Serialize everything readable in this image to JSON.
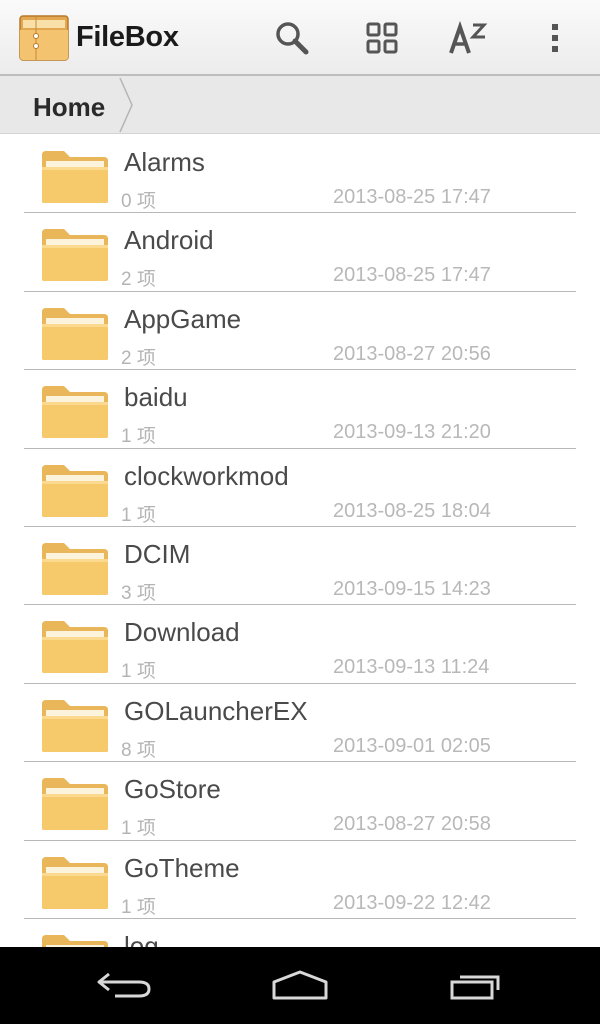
{
  "app": {
    "title": "FileBox",
    "logo_icon": "filebox-logo-icon"
  },
  "toolbar": {
    "search_icon": "search-icon",
    "grid_icon": "grid-view-icon",
    "sort_icon": "sort-az-icon",
    "more_icon": "overflow-menu-icon"
  },
  "breadcrumb": {
    "home_label": "Home"
  },
  "folders": [
    {
      "name": "Alarms",
      "count": "0 项",
      "date": "2013-08-25 17:47"
    },
    {
      "name": "Android",
      "count": "2 项",
      "date": "2013-08-25 17:47"
    },
    {
      "name": "AppGame",
      "count": "2 项",
      "date": "2013-08-27 20:56"
    },
    {
      "name": "baidu",
      "count": "1 项",
      "date": "2013-09-13 21:20"
    },
    {
      "name": "clockworkmod",
      "count": "1 项",
      "date": "2013-08-25 18:04"
    },
    {
      "name": "DCIM",
      "count": "3 项",
      "date": "2013-09-15 14:23"
    },
    {
      "name": "Download",
      "count": "1 项",
      "date": "2013-09-13 11:24"
    },
    {
      "name": "GOLauncherEX",
      "count": "8 项",
      "date": "2013-09-01 02:05"
    },
    {
      "name": "GoStore",
      "count": "1 项",
      "date": "2013-08-27 20:58"
    },
    {
      "name": "GoTheme",
      "count": "1 项",
      "date": "2013-09-22 12:42"
    },
    {
      "name": "log",
      "count": "",
      "date": ""
    }
  ],
  "navbar": {
    "back_icon": "back-icon",
    "home_icon": "home-icon",
    "recent_icon": "recent-apps-icon"
  },
  "colors": {
    "folder": "#f6c96a",
    "accent_text": "#4a4a4a",
    "meta_text": "#b8b8b8"
  }
}
